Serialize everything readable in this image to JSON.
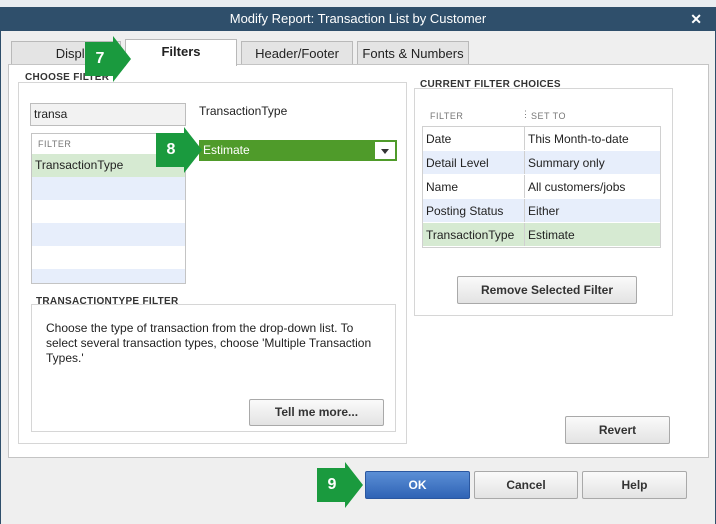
{
  "window": {
    "title": "Modify Report: Transaction List by Customer",
    "close_glyph": "✕"
  },
  "tabs": [
    {
      "label": "Display",
      "active": false
    },
    {
      "label": "Filters",
      "active": true
    },
    {
      "label": "Header/Footer",
      "active": false
    },
    {
      "label": "Fonts & Numbers",
      "active": false
    }
  ],
  "choose_filter": {
    "title": "CHOOSE FILTER",
    "search_value": "transa",
    "list_header": "FILTER",
    "items": [
      "TransactionType"
    ],
    "selected_filter_label": "TransactionType",
    "dropdown_value": "Estimate"
  },
  "filter_help": {
    "title": "TRANSACTIONTYPE FILTER",
    "text": "Choose the type of transaction from the drop-down list. To select several transaction types, choose 'Multiple Transaction Types.'",
    "tell_more_label": "Tell me more..."
  },
  "current_filters": {
    "title": "CURRENT FILTER CHOICES",
    "col_filter": "FILTER",
    "col_set_to": "SET TO",
    "rows": [
      {
        "filter": "Date",
        "value": "This Month-to-date"
      },
      {
        "filter": "Detail Level",
        "value": "Summary only"
      },
      {
        "filter": "Name",
        "value": "All customers/jobs"
      },
      {
        "filter": "Posting Status",
        "value": "Either"
      },
      {
        "filter": "TransactionType",
        "value": "Estimate"
      }
    ],
    "remove_label": "Remove Selected Filter"
  },
  "buttons": {
    "revert": "Revert",
    "ok": "OK",
    "cancel": "Cancel",
    "help": "Help"
  },
  "markers": [
    "7",
    "8",
    "9"
  ],
  "colors": {
    "marker_green": "#1a9a3e",
    "titlebar": "#2f4f6b",
    "dropdown_green": "#4f9b2a",
    "ok_blue": "#2f63b5"
  }
}
